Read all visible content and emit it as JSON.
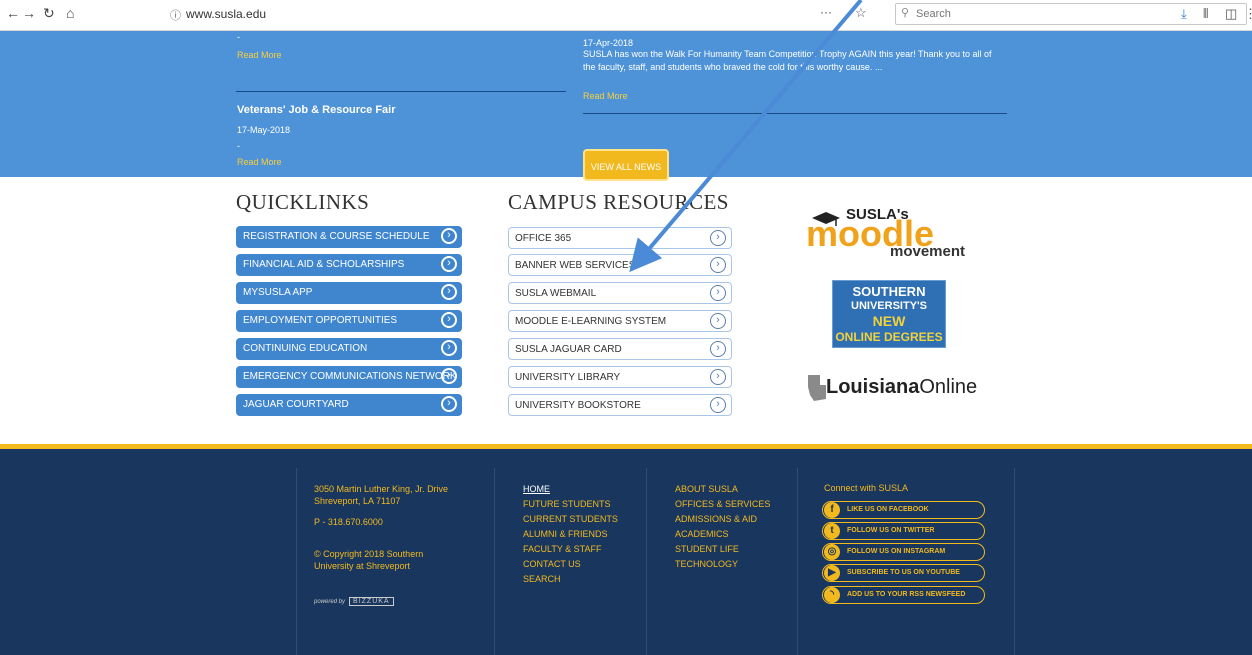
{
  "browser": {
    "url": "www.susla.edu",
    "info_icon": "ⓘ",
    "page_menu": "···",
    "search_placeholder": "Search"
  },
  "news": {
    "left_dash": "-",
    "left_readmore_top": "Read More",
    "item_title": "Veterans' Job & Resource Fair",
    "item_date": "17-May-2018",
    "item_dash": "-",
    "item_readmore": "Read More",
    "right_date": "17-Apr-2018",
    "right_text": "SUSLA has won the Walk For Humanity Team Competition Trophy AGAIN this year! Thank you to all of the faculty, staff, and students who braved the cold for this worthy cause. ...",
    "right_readmore": "Read More",
    "view_all": "VIEW ALL NEWS"
  },
  "quicklinks": {
    "title": "QUICKLINKS",
    "items": [
      "REGISTRATION & COURSE SCHEDULE",
      "FINANCIAL AID & SCHOLARSHIPS",
      "MYSUSLA APP",
      "EMPLOYMENT OPPORTUNITIES",
      "CONTINUING EDUCATION",
      "EMERGENCY COMMUNICATIONS NETWORK",
      "JAGUAR COURTYARD"
    ]
  },
  "campus_resources": {
    "title": "CAMPUS RESOURCES",
    "items": [
      "OFFICE 365",
      "BANNER WEB SERVICES",
      "SUSLA WEBMAIL",
      "MOODLE E-LEARNING SYSTEM",
      "SUSLA JAGUAR CARD",
      "UNIVERSITY LIBRARY",
      "UNIVERSITY BOOKSTORE"
    ]
  },
  "logos": {
    "moodle_top": "SUSLA's",
    "moodle_main": "moodle",
    "moodle_sub": "movement",
    "southern_lines": [
      "SOUTHERN",
      "UNIVERSITY'S",
      "NEW",
      "ONLINE DEGREES"
    ],
    "louisiana_a": "Louisiana",
    "louisiana_b": "Online"
  },
  "footer": {
    "address_1": "3050 Martin Luther King, Jr. Drive",
    "address_2": "Shreveport, LA 71107",
    "phone": "P - 318.670.6000",
    "copyright_1": "© Copyright 2018 Southern",
    "copyright_2": "University at Shreveport",
    "powered_by": "powered by",
    "powered_brand": "BIZZUKA",
    "nav1": [
      "HOME",
      "FUTURE STUDENTS",
      "CURRENT STUDENTS",
      "ALUMNI & FRIENDS",
      "FACULTY & STAFF",
      "CONTACT US",
      "SEARCH"
    ],
    "nav2": [
      "ABOUT SUSLA",
      "OFFICES & SERVICES",
      "ADMISSIONS & AID",
      "ACADEMICS",
      "STUDENT LIFE",
      "TECHNOLOGY"
    ],
    "connect_title": "Connect with SUSLA",
    "social": [
      {
        "label": "LIKE US ON FACEBOOK",
        "icon": "f"
      },
      {
        "label": "FOLLOW US ON TWITTER",
        "icon": "t"
      },
      {
        "label": "FOLLOW US ON INSTAGRAM",
        "icon": "◎"
      },
      {
        "label": "SUBSCRIBE TO US ON YOUTUBE",
        "icon": "▶"
      },
      {
        "label": "ADD US TO YOUR RSS NEWSFEED",
        "icon": "◝"
      }
    ]
  },
  "colors": {
    "news_band": "#4e93d7",
    "gold": "#f2b91e",
    "footer": "#19365e",
    "annotation_arrow": "#4a8ad6"
  }
}
